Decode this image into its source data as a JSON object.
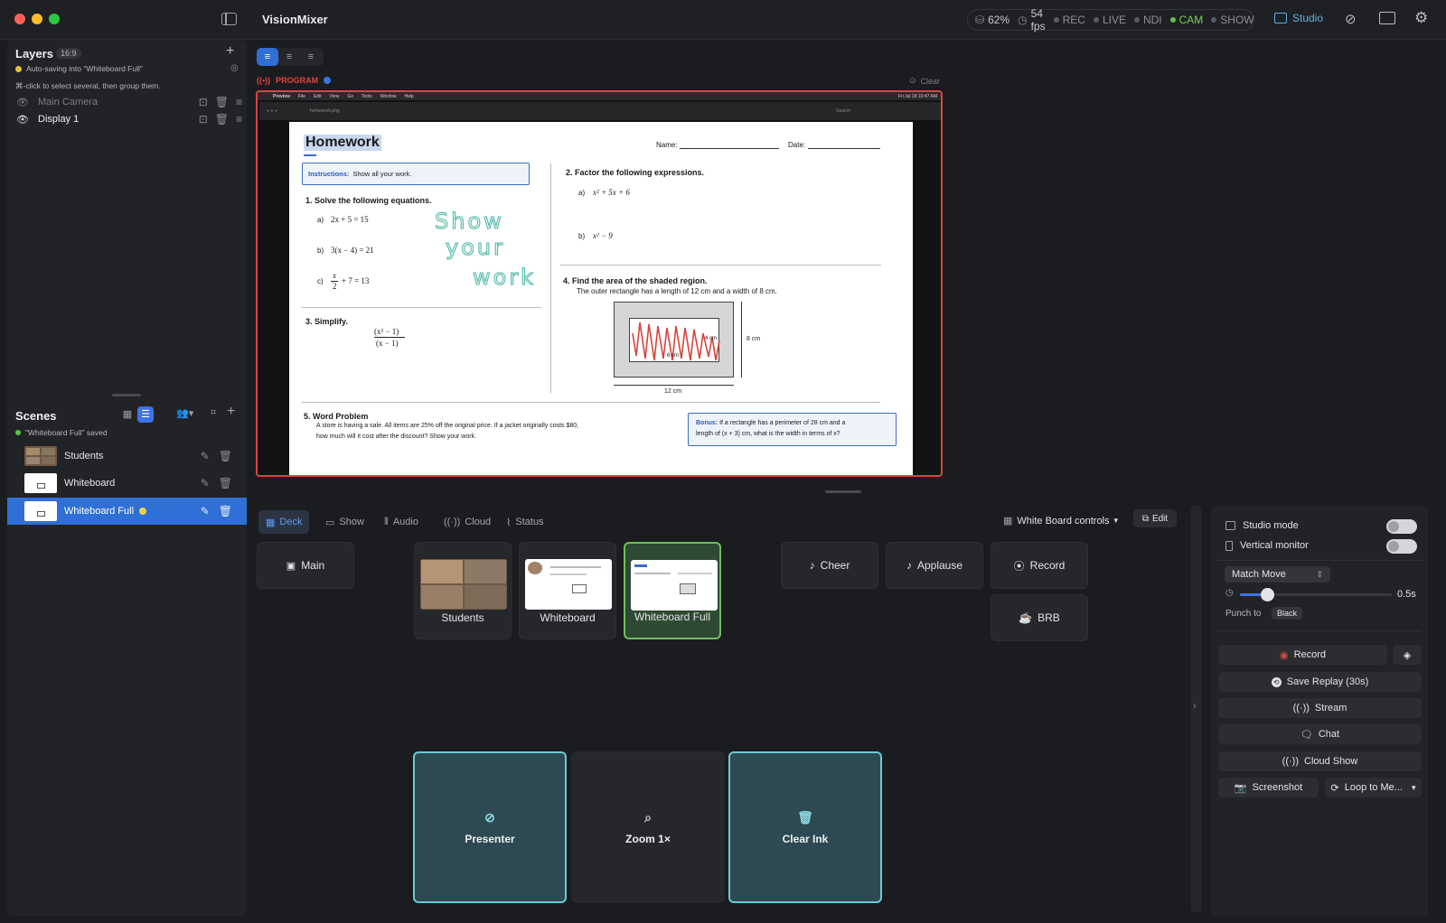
{
  "app": {
    "title": "VisionMixer"
  },
  "status": {
    "cpu": "62%",
    "fps": "54 fps",
    "indicators": [
      "REC",
      "LIVE",
      "NDI",
      "CAM",
      "SHOW"
    ],
    "active_indicator": "CAM",
    "studio_label": "Studio"
  },
  "layers": {
    "title": "Layers",
    "aspect": "16:9",
    "autosave": "Auto-saving into \"Whiteboard Full\"",
    "hint": "⌘-click to select several, then group them.",
    "items": [
      {
        "label": "Main Camera"
      },
      {
        "label": "Display 1"
      }
    ]
  },
  "scenes": {
    "title": "Scenes",
    "saved": "\"Whiteboard Full\" saved",
    "items": [
      {
        "label": "Students"
      },
      {
        "label": "Whiteboard"
      },
      {
        "label": "Whiteboard Full"
      }
    ]
  },
  "program": {
    "label": "PROGRAM",
    "clear": "Clear",
    "menubar": [
      "Preview",
      "File",
      "Edit",
      "View",
      "Go",
      "Tools",
      "Window",
      "Help"
    ],
    "clock": "Fri Jul 18 10:47 AM",
    "filename": "homework.png",
    "search": "Search"
  },
  "worksheet": {
    "title": "Homework",
    "name_label": "Name:",
    "date_label": "Date:",
    "instructions_label": "Instructions:",
    "instructions_text": "Show all your work.",
    "q1": "1.  Solve the following equations.",
    "q1a_label": "a)",
    "q1a": "2x + 5 = 15",
    "q1b_label": "b)",
    "q1b": "3(x − 4) = 21",
    "q1c_label": "c)",
    "q1c_num": "x",
    "q1c_den": "2",
    "q1c_rest": "+ 7 = 13",
    "handwriting": [
      "Show",
      "your",
      "work"
    ],
    "q2": "2.  Factor the following expressions.",
    "q2a_label": "a)",
    "q2a": "x² + 5x + 6",
    "q2b_label": "b)",
    "q2b": "x² − 9",
    "q3": "3.  Simplify.",
    "q3_num": "(x² − 1)",
    "q3_den": "(x − 1)",
    "q4": "4.  Find the area of the shaded region.",
    "q4_text": "The outer rectangle has a length of 12 cm and a width of 8 cm.",
    "q4_h": "8 cm",
    "q4_w": "12 cm",
    "q4_inner_h": "4 cm",
    "q4_inner_w": "6 cm",
    "q5": "5.  Word Problem",
    "q5_text1": "A store is having a sale. All items are 25% off the original price. If a jacket originally costs $80,",
    "q5_text2": "how much will it cost after the discount? Show your work.",
    "bonus_label": "Bonus:",
    "bonus_text1": "If a rectangle has a perimeter of 28 cm and a",
    "bonus_text2": "length of (x + 3) cm, what is the width in terms of x?"
  },
  "tabs": [
    {
      "label": "Deck",
      "icon": "grid-icon"
    },
    {
      "label": "Show",
      "icon": "screen-icon"
    },
    {
      "label": "Audio",
      "icon": "audio-bars-icon"
    },
    {
      "label": "Cloud",
      "icon": "broadcast-icon"
    },
    {
      "label": "Status",
      "icon": "pulse-icon"
    }
  ],
  "deck": {
    "controls_label": "White Board controls",
    "edit_label": "Edit",
    "main_label": "Main",
    "scene_cards": [
      {
        "label": "Students"
      },
      {
        "label": "Whiteboard"
      },
      {
        "label": "Whiteboard Full"
      }
    ],
    "cheer": "Cheer",
    "applause": "Applause",
    "record": "Record",
    "brb": "BRB",
    "presenter": "Presenter",
    "zoom": "Zoom 1×",
    "clear_ink": "Clear Ink"
  },
  "panel": {
    "studio_mode": "Studio mode",
    "vertical_monitor": "Vertical monitor",
    "transition": "Match Move",
    "duration": "0.5s",
    "duration_fraction": 0.18,
    "punch_label": "Punch to",
    "punch_value": "Black",
    "record": "Record",
    "save_replay": "Save Replay (30s)",
    "stream": "Stream",
    "chat": "Chat",
    "cloud_show": "Cloud Show",
    "screenshot": "Screenshot",
    "loop": "Loop to Me..."
  },
  "colors": {
    "program_border": "#d9463f",
    "selected": "#2f6fd6",
    "active_green": "#6fbf5a",
    "teal": "#6cc9d8"
  }
}
